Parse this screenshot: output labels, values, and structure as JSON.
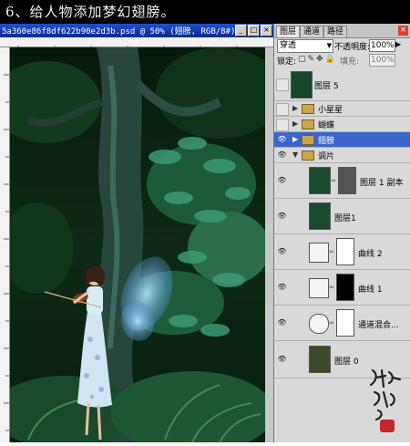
{
  "banner": {
    "text": "6、给人物添加梦幻翅膀。"
  },
  "document": {
    "title": "5a360e86f8df622b90e2d3b.psd @ 50% (翅膀, RGB/8#)",
    "buttons": {
      "minimize": "_",
      "maximize": "□",
      "close": "×"
    }
  },
  "panel": {
    "tabs": [
      "图层",
      "通道",
      "路径"
    ],
    "close": "×",
    "blend_mode": "穿透",
    "opacity_label": "不透明度:",
    "opacity_value": "100%",
    "lock_label": "锁定:",
    "fill_label": "填充:",
    "fill_value": "100%",
    "layers": [
      {
        "name": "图层 5",
        "kind": "pixel",
        "visible": true
      },
      {
        "name": "小星星",
        "kind": "group",
        "visible": false
      },
      {
        "name": "蝴蝶",
        "kind": "group",
        "visible": false
      },
      {
        "name": "翅膀",
        "kind": "group",
        "visible": true,
        "selected": true
      },
      {
        "name": "调片",
        "kind": "group",
        "visible": true,
        "expanded": true
      },
      {
        "name": "图层 1 副本",
        "kind": "pixel-masked",
        "visible": true
      },
      {
        "name": "图层1",
        "kind": "pixel",
        "visible": true
      },
      {
        "name": "曲线 2",
        "kind": "adjustment",
        "visible": true
      },
      {
        "name": "曲线 1",
        "kind": "adjustment",
        "visible": true
      },
      {
        "name": "通道混合...",
        "kind": "adjustment",
        "visible": true
      },
      {
        "name": "图层 0",
        "kind": "pixel",
        "visible": true
      }
    ]
  },
  "colors": {
    "selected_layer": "#3a66c9",
    "title_bar": "#1f4fd0",
    "banner": "#000000"
  },
  "icons": [
    "eye-icon",
    "folder-icon",
    "chain-link-icon",
    "lock-icon",
    "brush-icon",
    "move-icon"
  ]
}
